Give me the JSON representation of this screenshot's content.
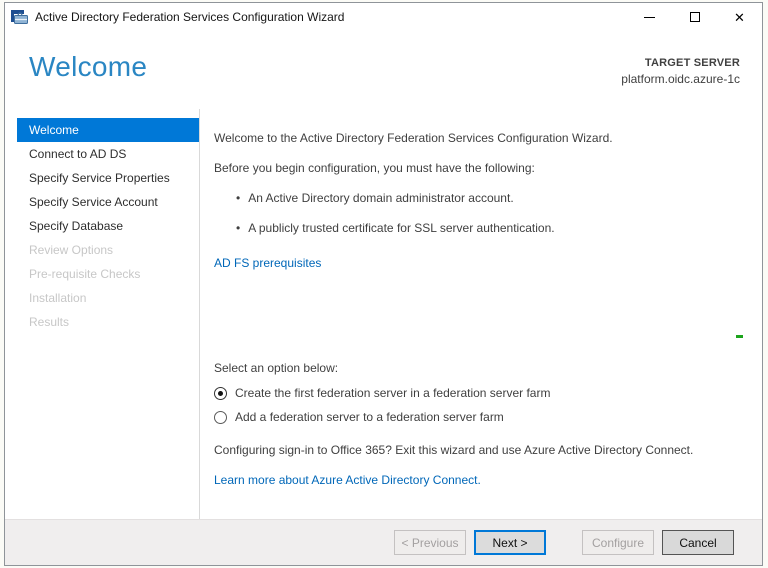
{
  "window": {
    "title": "Active Directory Federation Services Configuration Wizard",
    "close_glyph": "✕"
  },
  "header": {
    "page_title": "Welcome",
    "target_server_label": "TARGET SERVER",
    "target_server_value": "platform.oidc.azure-1c"
  },
  "sidebar": {
    "items": [
      {
        "label": "Welcome",
        "state": "active"
      },
      {
        "label": "Connect to AD DS",
        "state": "enabled"
      },
      {
        "label": "Specify Service Properties",
        "state": "enabled"
      },
      {
        "label": "Specify Service Account",
        "state": "enabled"
      },
      {
        "label": "Specify Database",
        "state": "enabled"
      },
      {
        "label": "Review Options",
        "state": "disabled"
      },
      {
        "label": "Pre-requisite Checks",
        "state": "disabled"
      },
      {
        "label": "Installation",
        "state": "disabled"
      },
      {
        "label": "Results",
        "state": "disabled"
      }
    ]
  },
  "content": {
    "intro": "Welcome to the Active Directory Federation Services Configuration Wizard.",
    "requirements_intro": "Before you begin configuration, you must have the following:",
    "bullet_glyph": "•",
    "bullets": [
      "An Active Directory domain administrator account.",
      "A publicly trusted certificate for SSL server authentication."
    ],
    "prerequisites_link": "AD FS prerequisites",
    "select_option_label": "Select an option below:",
    "options": [
      {
        "label": "Create the first federation server in a federation server farm",
        "selected": true
      },
      {
        "label": "Add a federation server to a federation server farm",
        "selected": false
      }
    ],
    "office365_note": "Configuring sign-in to Office 365? Exit this wizard and use Azure Active Directory Connect.",
    "learn_more_link": "Learn more about Azure Active Directory Connect."
  },
  "footer": {
    "buttons": [
      {
        "label": "< Previous",
        "enabled": false
      },
      {
        "label": "Next >",
        "enabled": true,
        "default": true
      },
      {
        "label": "Configure",
        "enabled": false
      },
      {
        "label": "Cancel",
        "enabled": true
      }
    ]
  },
  "colors": {
    "accent_blue": "#0078d7",
    "heading_blue": "#2a86c3",
    "link_blue": "#0067b8",
    "footer_bg": "#f0eeee",
    "disabled_text": "#c7c7c7"
  }
}
